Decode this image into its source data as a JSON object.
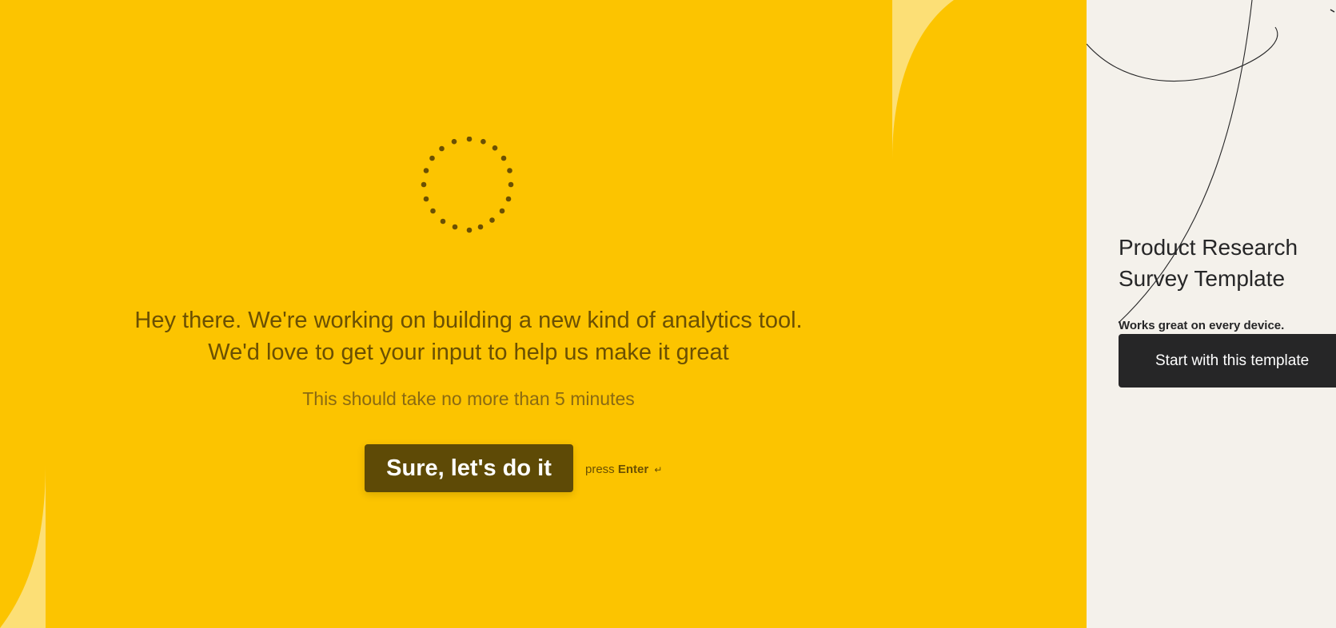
{
  "preview": {
    "headline_line1": "Hey there. We're working on building a new kind of analytics tool.",
    "headline_line2": "We'd love to get your input to help us make it great",
    "subline": "This should take no more than 5 minutes",
    "cta_label": "Sure, let's do it",
    "press_prefix": "press",
    "press_key": "Enter",
    "press_glyph": "↵",
    "colors": {
      "background": "#fcc400",
      "background_light": "#fcdf76",
      "text": "#6b5003",
      "button": "#5e4a06",
      "spinner_dots": "#6b5003"
    },
    "icons": {
      "spinner": "dotted-circle-loading-icon",
      "enter": "enter-key-icon"
    }
  },
  "side_panel": {
    "title_line1": "Product Research",
    "title_line2": "Survey Template",
    "note": "Works great on every device.",
    "button_label": "Start with this template",
    "colors": {
      "background": "#f4f1eb",
      "text": "#262627",
      "button": "#262627"
    }
  }
}
